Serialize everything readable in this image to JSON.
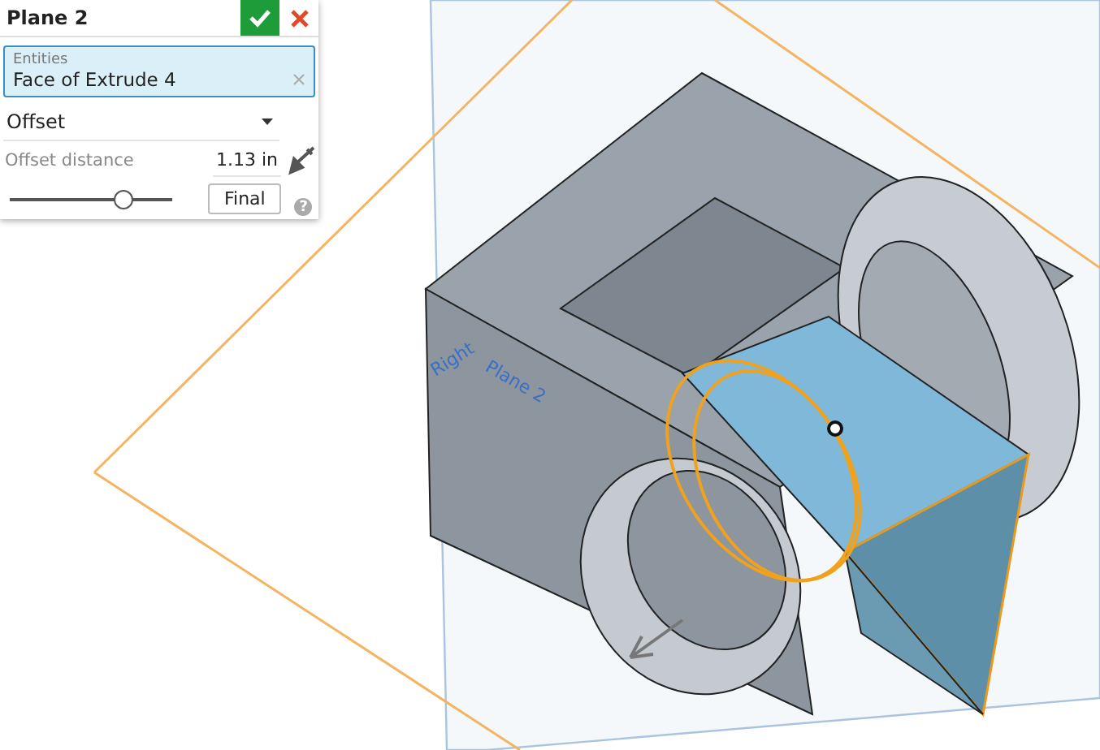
{
  "dialog": {
    "title": "Plane 2",
    "entities": {
      "label": "Entities",
      "value": "Face of Extrude 4"
    },
    "type_dropdown": {
      "value": "Offset"
    },
    "offset_distance": {
      "label": "Offset distance",
      "value": "1.13 in"
    },
    "slider": {
      "level": 0.7
    },
    "final_button": "Final",
    "help": "?"
  },
  "viewport": {
    "plane_labels": [
      {
        "text": "Right"
      },
      {
        "text": "Plane 2"
      }
    ]
  }
}
